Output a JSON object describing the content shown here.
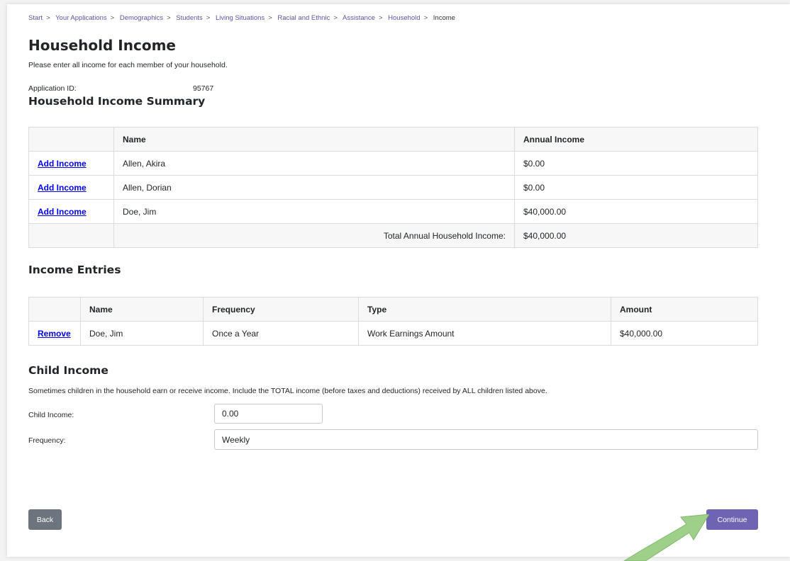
{
  "breadcrumb": {
    "items": [
      "Start",
      "Your Applications",
      "Demographics",
      "Students",
      "Living Situations",
      "Racial and Ethnic",
      "Assistance",
      "Household"
    ],
    "current": "Income",
    "separator": ">"
  },
  "page": {
    "title": "Household Income",
    "intro": "Please enter all income for each member of your household.",
    "application_id_label": "Application ID:",
    "application_id": "95767"
  },
  "summary": {
    "heading": "Household Income Summary",
    "headers": [
      "",
      "Name",
      "Annual Income"
    ],
    "rows": [
      {
        "action": "Add Income",
        "name": "Allen, Akira",
        "income": "$0.00"
      },
      {
        "action": "Add Income",
        "name": "Allen, Dorian",
        "income": "$0.00"
      },
      {
        "action": "Add Income",
        "name": "Doe, Jim",
        "income": "$40,000.00"
      }
    ],
    "total_label": "Total Annual Household Income:",
    "total_value": "$40,000.00"
  },
  "entries": {
    "heading": "Income Entries",
    "headers": [
      "",
      "Name",
      "Frequency",
      "Type",
      "Amount"
    ],
    "rows": [
      {
        "action": "Remove",
        "name": "Doe, Jim",
        "frequency": "Once a Year",
        "type": "Work Earnings Amount",
        "amount": "$40,000.00"
      }
    ]
  },
  "child": {
    "heading": "Child Income",
    "description": "Sometimes children in the household earn or receive income. Include the TOTAL income (before taxes and deductions) received by ALL children listed above.",
    "income_label": "Child Income:",
    "income_value": "0.00",
    "frequency_label": "Frequency:",
    "frequency_value": "Weekly"
  },
  "buttons": {
    "back": "Back",
    "continue": "Continue"
  },
  "colors": {
    "accent": "#6f63b4",
    "arrow": "#9ed08a"
  }
}
